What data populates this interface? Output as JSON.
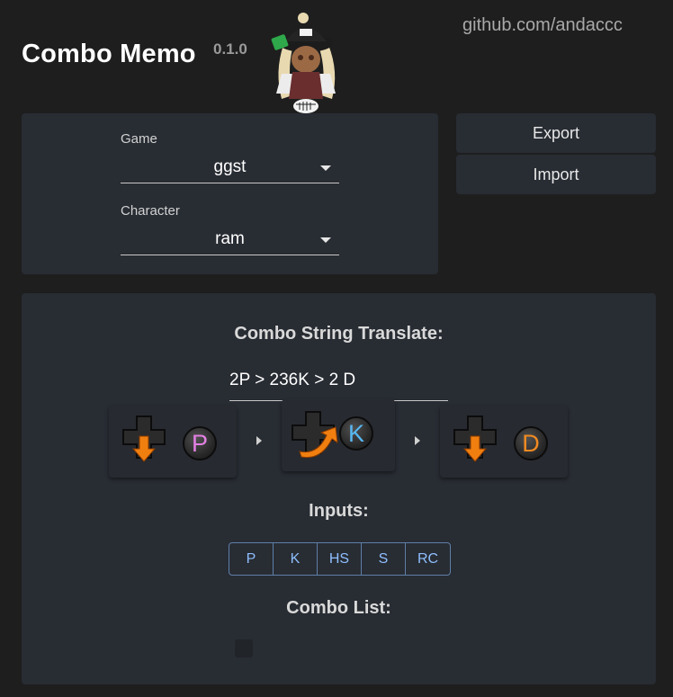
{
  "header": {
    "title": "Combo Memo",
    "version": "0.1.0",
    "github_link": "github.com/andaccc"
  },
  "selectors": {
    "game": {
      "label": "Game",
      "value": "ggst"
    },
    "character": {
      "label": "Character",
      "value": "ram"
    }
  },
  "actions": {
    "export_label": "Export",
    "import_label": "Import"
  },
  "translate": {
    "heading": "Combo String Translate:",
    "input_value": "2P > 236K > 2 D",
    "moves": [
      {
        "motion": "down-arrow",
        "button": "P",
        "color": "#e27fe2"
      },
      {
        "motion": "quarter-circle-forward",
        "button": "K",
        "color": "#57b8f0"
      },
      {
        "motion": "down-arrow",
        "button": "D",
        "color": "#f08a22"
      }
    ]
  },
  "inputs": {
    "heading": "Inputs:",
    "buttons": [
      "P",
      "K",
      "HS",
      "S",
      "RC"
    ]
  },
  "combo_list": {
    "heading": "Combo List:"
  }
}
